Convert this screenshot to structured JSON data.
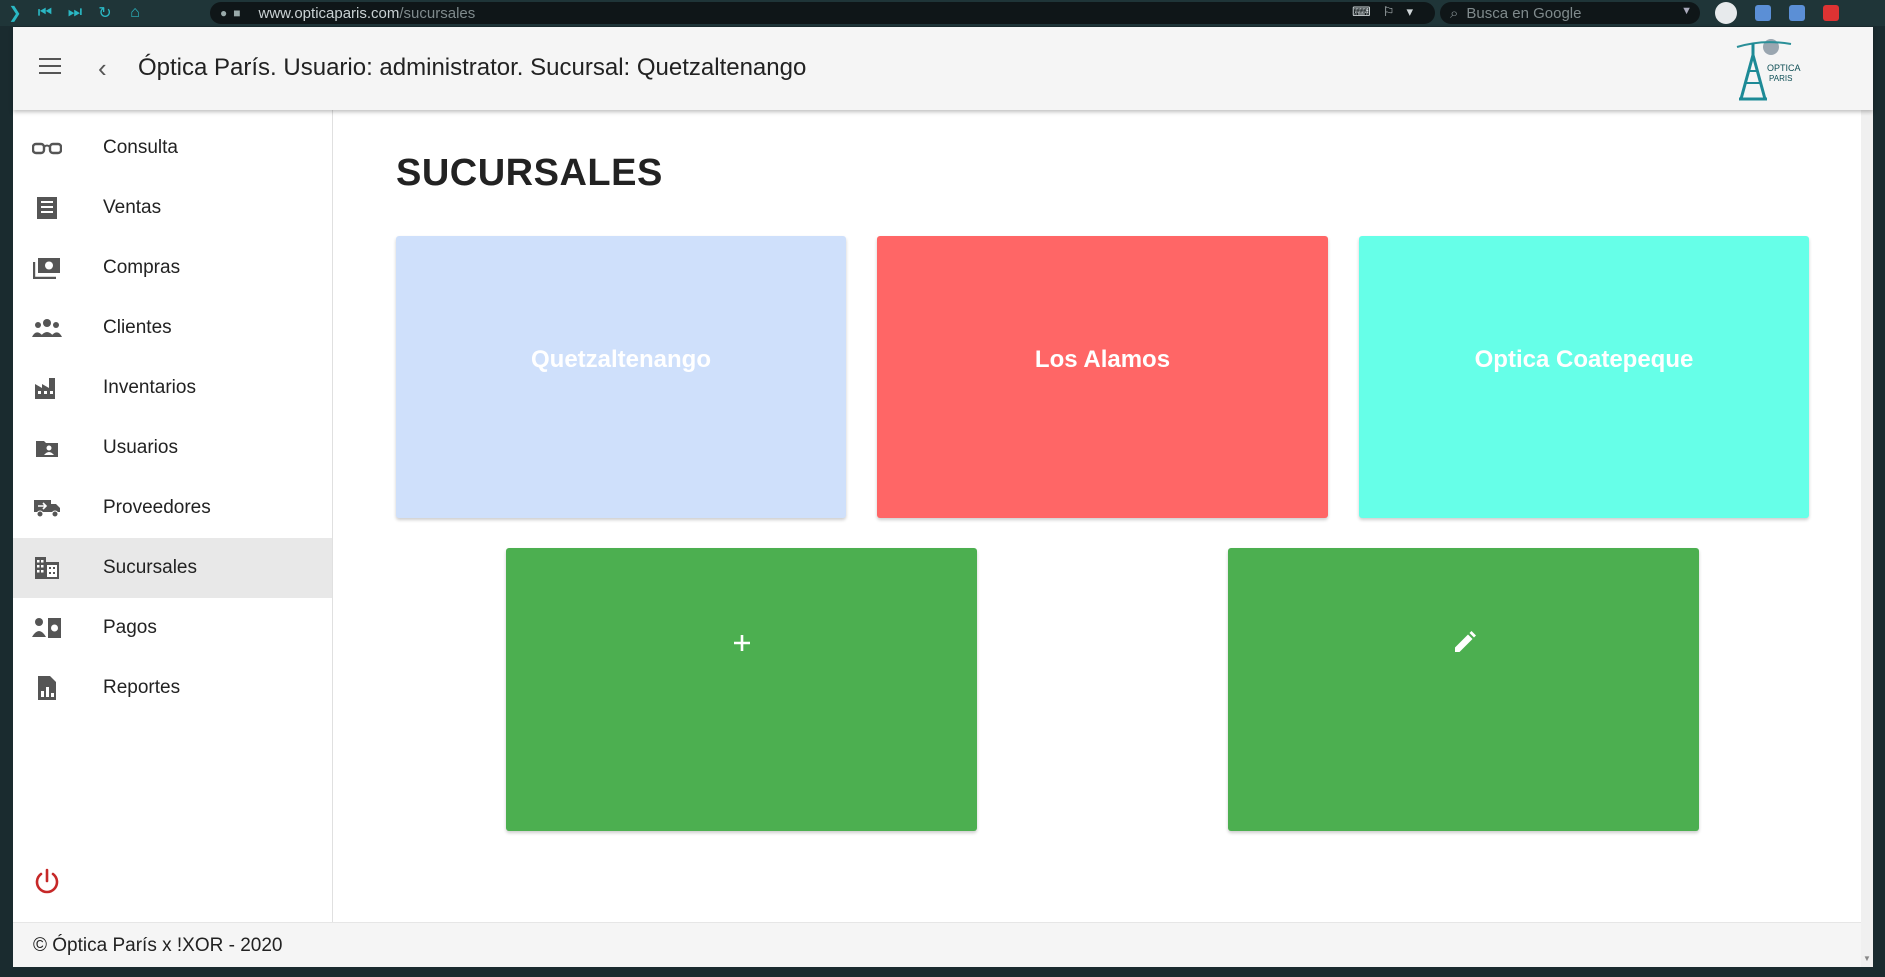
{
  "browser": {
    "url_domain": "www.opticaparis.com",
    "url_path": "/sucursales",
    "search_placeholder": "Busca en Google"
  },
  "header": {
    "title": "Óptica París. Usuario: administrator. Sucursal: Quetzaltenango",
    "logo_text_1": "OPTICA",
    "logo_text_2": "PARIS"
  },
  "sidebar": {
    "items": [
      {
        "label": "Consulta",
        "icon": "glasses-icon"
      },
      {
        "label": "Ventas",
        "icon": "receipt-icon"
      },
      {
        "label": "Compras",
        "icon": "money-icon"
      },
      {
        "label": "Clientes",
        "icon": "people-icon"
      },
      {
        "label": "Inventarios",
        "icon": "factory-icon"
      },
      {
        "label": "Usuarios",
        "icon": "user-folder-icon"
      },
      {
        "label": "Proveedores",
        "icon": "truck-icon"
      },
      {
        "label": "Sucursales",
        "icon": "business-icon"
      },
      {
        "label": "Pagos",
        "icon": "payments-icon"
      },
      {
        "label": "Reportes",
        "icon": "report-icon"
      }
    ],
    "active_index": 7,
    "power_color": "#c62828"
  },
  "main": {
    "title": "SUCURSALES",
    "branches": [
      {
        "name": "Quetzaltenango",
        "color": "#cfe0fb"
      },
      {
        "name": "Los Alamos",
        "color": "#ff6666"
      },
      {
        "name": "Optica Coatepeque",
        "color": "#66ffe8"
      }
    ],
    "actions": [
      {
        "icon": "plus-icon",
        "color": "#4caf50"
      },
      {
        "icon": "pencil-icon",
        "color": "#4caf50"
      }
    ]
  },
  "footer": {
    "text": "© Óptica París x !XOR - 2020"
  }
}
